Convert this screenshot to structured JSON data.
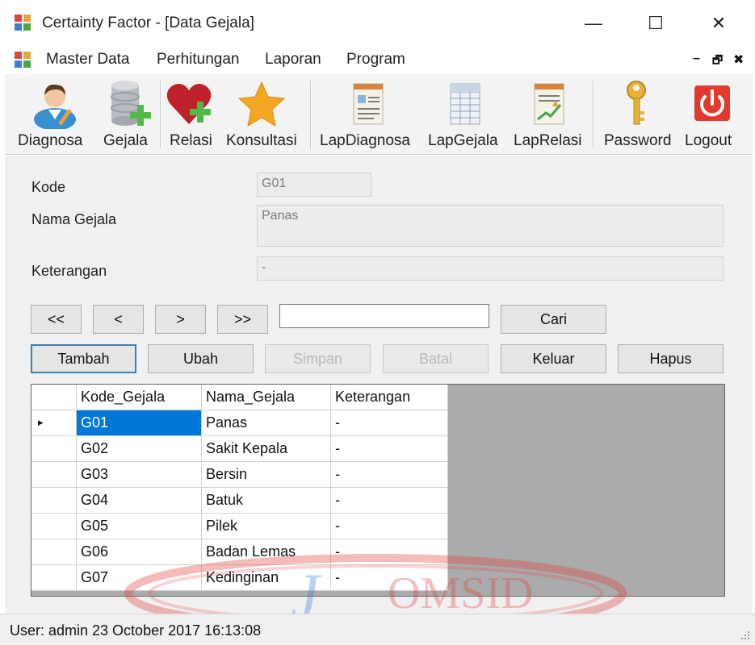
{
  "window": {
    "title": "Certainty Factor - [Data Gejala]",
    "minimize_glyph": "—",
    "maximize_glyph": "☐",
    "close_glyph": "✕"
  },
  "menu": {
    "items": [
      "Master Data",
      "Perhitungan",
      "Laporan",
      "Program"
    ],
    "mdi_min": "–",
    "mdi_restore": "🗗",
    "mdi_close": "✖"
  },
  "toolbar": {
    "buttons": [
      {
        "label": "Diagnosa",
        "icon": "doctor-icon"
      },
      {
        "label": "Gejala",
        "icon": "database-add-icon"
      },
      {
        "label": "Relasi",
        "icon": "heart-add-icon"
      },
      {
        "label": "Konsultasi",
        "icon": "star-icon"
      },
      {
        "label": "LapDiagnosa",
        "icon": "report-icon"
      },
      {
        "label": "LapGejala",
        "icon": "spreadsheet-report-icon"
      },
      {
        "label": "LapRelasi",
        "icon": "chart-report-icon"
      },
      {
        "label": "Password",
        "icon": "key-icon"
      },
      {
        "label": "Logout",
        "icon": "power-icon"
      }
    ]
  },
  "form": {
    "kode_label": "Kode",
    "kode_value": "G01",
    "nama_label": "Nama Gejala",
    "nama_value": "Panas",
    "keterangan_label": "Keterangan",
    "keterangan_value": "-",
    "search_value": ""
  },
  "nav": {
    "first": "<<",
    "prev": "<",
    "next": ">",
    "last": ">>",
    "cari": "Cari"
  },
  "actions": {
    "tambah": "Tambah",
    "ubah": "Ubah",
    "simpan": "Simpan",
    "batal": "Batal",
    "keluar": "Keluar",
    "hapus": "Hapus"
  },
  "grid": {
    "columns": [
      "Kode_Gejala",
      "Nama_Gejala",
      "Keterangan"
    ],
    "rows": [
      [
        "G01",
        "Panas",
        "-"
      ],
      [
        "G02",
        "Sakit Kepala",
        "-"
      ],
      [
        "G03",
        "Bersin",
        "-"
      ],
      [
        "G04",
        "Batuk",
        "-"
      ],
      [
        "G05",
        "Pilek",
        "-"
      ],
      [
        "G06",
        "Badan Lemas",
        "-"
      ],
      [
        "G07",
        "Kedinginan",
        "-"
      ]
    ],
    "current_row_marker": "▸"
  },
  "status": {
    "text": "User: admin  23 October 2017 16:13:08"
  },
  "watermark": {
    "text": "OMSID"
  },
  "colors": {
    "selection": "#0078d7",
    "default_button_border": "#3c7fb1",
    "watermark": "#e03c3c"
  }
}
